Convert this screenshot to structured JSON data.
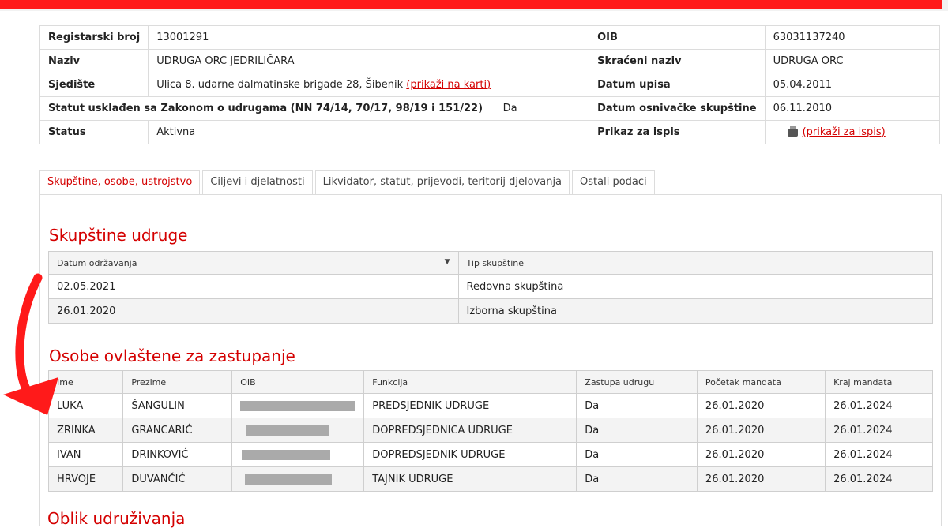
{
  "info": {
    "registarski_broj_label": "Registarski broj",
    "registarski_broj": "13001291",
    "oib_label": "OIB",
    "oib": "63031137240",
    "naziv_label": "Naziv",
    "naziv": "UDRUGA ORC JEDRILIČARA",
    "skraceni_label": "Skraćeni naziv",
    "skraceni": "UDRUGA ORC",
    "sjediste_label": "Sjedište",
    "sjediste": "Ulica 8. udarne dalmatinske brigade 28, Šibenik",
    "sjediste_link": "(prikaži na karti)",
    "datum_upisa_label": "Datum upisa",
    "datum_upisa": "05.04.2011",
    "statut_label": "Statut usklađen sa Zakonom o udrugama (NN 74/14, 70/17, 98/19 i 151/22)",
    "statut": "Da",
    "osnivacka_label": "Datum osnivačke skupštine",
    "osnivacka": "06.11.2010",
    "status_label": "Status",
    "status": "Aktivna",
    "ispis_label": "Prikaz za ispis",
    "ispis_link": "(prikaži za ispis)"
  },
  "tabs": [
    "Skupštine, osobe, ustrojstvo",
    "Ciljevi i djelatnosti",
    "Likvidator, statut, prijevodi, teritorij djelovanja",
    "Ostali podaci"
  ],
  "skupstine": {
    "title": "Skupštine udruge",
    "headers": [
      "Datum održavanja",
      "Tip skupštine"
    ],
    "rows": [
      [
        "02.05.2021",
        "Redovna skupština"
      ],
      [
        "26.01.2020",
        "Izborna skupština"
      ]
    ]
  },
  "osobe": {
    "title": "Osobe ovlaštene za zastupanje",
    "headers": [
      "Ime",
      "Prezime",
      "OIB",
      "Funkcija",
      "Zastupa udrugu",
      "Početak mandata",
      "Kraj mandata"
    ],
    "rows": [
      [
        "LUKA",
        "ŠANGULIN",
        "",
        "PREDSJEDNIK UDRUGE",
        "Da",
        "26.01.2020",
        "26.01.2024"
      ],
      [
        "ZRINKA",
        "GRANCARIĆ",
        "",
        "DOPREDSJEDNICA UDRUGE",
        "Da",
        "26.01.2020",
        "26.01.2024"
      ],
      [
        "IVAN",
        "DRINKOVIĆ",
        "",
        "DOPREDSJEDNIK UDRUGE",
        "Da",
        "26.01.2020",
        "26.01.2024"
      ],
      [
        "HRVOJE",
        "DUVANČIĆ",
        "",
        "TAJNIK UDRUGE",
        "Da",
        "26.01.2020",
        "26.01.2024"
      ]
    ]
  },
  "oblik_title": "Oblik udruživanja",
  "colors": {
    "accent": "#d40000",
    "annotation_red": "#ff1a1a"
  }
}
